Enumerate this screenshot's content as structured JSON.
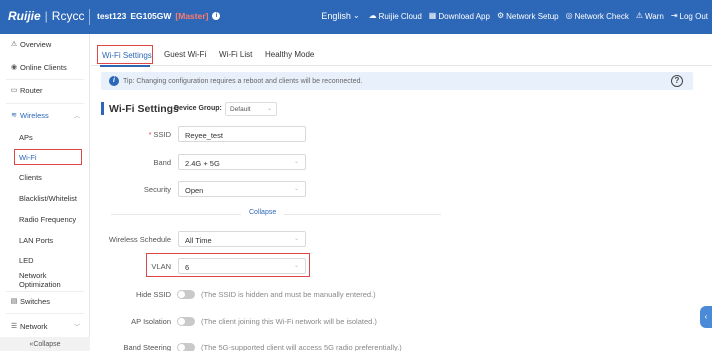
{
  "header": {
    "logo_brand": "Ruijie",
    "logo_sub": "Rcycc",
    "device_name": "test123",
    "device_model": "EG105GW",
    "device_role": "[Master]",
    "language": "English",
    "nav": [
      {
        "label": "Ruijie Cloud",
        "icon": "cloud-icon"
      },
      {
        "label": "Download App",
        "icon": "grid-icon"
      },
      {
        "label": "Network Setup",
        "icon": "network-icon"
      },
      {
        "label": "Network Check",
        "icon": "check-icon"
      },
      {
        "label": "Warn",
        "icon": "warn-icon"
      },
      {
        "label": "Log Out",
        "icon": "logout-icon"
      }
    ],
    "bg_color": "#2d67b7"
  },
  "sidebar": {
    "items": [
      {
        "label": "Overview",
        "icon": "overview-icon"
      },
      {
        "label": "Online Clients",
        "icon": "clients-icon"
      },
      {
        "label": "Router",
        "icon": "router-icon"
      },
      {
        "label": "Wireless",
        "icon": "wifi-icon"
      },
      {
        "label": "APs"
      },
      {
        "label": "Wi-Fi"
      },
      {
        "label": "Clients"
      },
      {
        "label": "Blacklist/Whitelist"
      },
      {
        "label": "Radio Frequency"
      },
      {
        "label": "LAN Ports"
      },
      {
        "label": "LED"
      },
      {
        "label": "Network Optimization"
      },
      {
        "label": "Switches",
        "icon": "switch-icon"
      },
      {
        "label": "Network",
        "icon": "network-tree-icon"
      }
    ],
    "collapse_label": "Collapse"
  },
  "tabs": [
    "Wi-Fi Settings",
    "Guest Wi-Fi",
    "Wi-Fi List",
    "Healthy Mode"
  ],
  "tip": "Tip: Changing configuration requires a reboot and clients will be reconnected.",
  "section": {
    "title": "Wi-Fi Settings",
    "device_group_label": "Device Group:",
    "device_group_value": "Default"
  },
  "form": {
    "ssid_label": "SSID",
    "ssid_value": "Reyee_test",
    "band_label": "Band",
    "band_value": "2.4G + 5G",
    "security_label": "Security",
    "security_value": "Open",
    "collapse_label": "Collapse",
    "schedule_label": "Wireless Schedule",
    "schedule_value": "All Time",
    "vlan_label": "VLAN",
    "vlan_value": "6",
    "hide_ssid_label": "Hide SSID",
    "hide_ssid_desc": "(The SSID is hidden and must be manually entered.)",
    "ap_isolation_label": "AP Isolation",
    "ap_isolation_desc": "(The client joining this Wi-Fi network will be isolated.)",
    "band_steering_label": "Band Steering",
    "band_steering_desc": "(The 5G-supported client will access 5G radio preferentially.)"
  },
  "accent_color": "#2d67b7",
  "highlight_color": "#e04848"
}
